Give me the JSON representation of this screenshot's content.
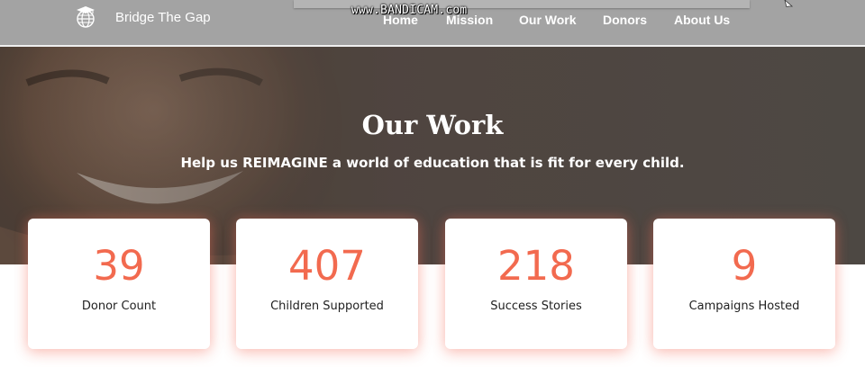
{
  "header": {
    "brand_name": "Bridge The Gap",
    "logo_icon": "globe-graduation-cap-icon",
    "nav": [
      {
        "label": "Home"
      },
      {
        "label": "Mission"
      },
      {
        "label": "Our Work"
      },
      {
        "label": "Donors"
      },
      {
        "label": "About Us"
      }
    ]
  },
  "watermark": "www.BANDICAM.com",
  "hero": {
    "title": "Our Work",
    "subtitle": "Help us REIMAGINE a world of education that is fit for every child."
  },
  "stats": [
    {
      "value": "39",
      "label": "Donor Count"
    },
    {
      "value": "407",
      "label": "Children Supported"
    },
    {
      "value": "218",
      "label": "Success Stories"
    },
    {
      "value": "9",
      "label": "Campaigns Hosted"
    }
  ],
  "colors": {
    "header_bg": "#a3a3a3",
    "accent": "#f26a4f",
    "card_bg": "#ffffff",
    "label_text": "#1f1f1f"
  }
}
